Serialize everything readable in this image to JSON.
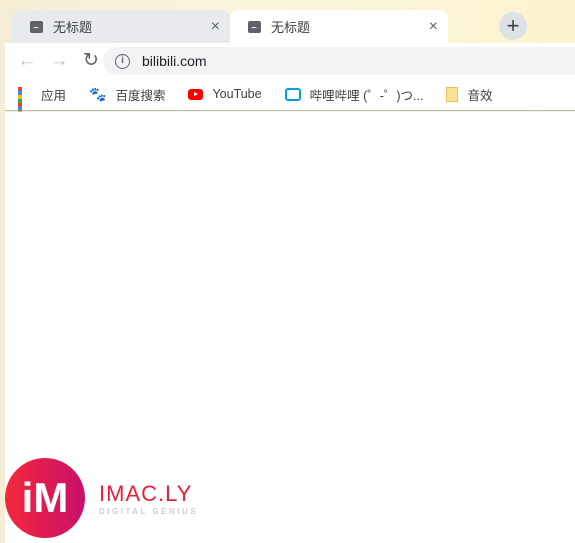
{
  "tabs": [
    {
      "title": "无标题",
      "active": false
    },
    {
      "title": "无标题",
      "active": true
    }
  ],
  "tab_close": "×",
  "new_tab": "+",
  "toolbar": {
    "back": "←",
    "forward": "→",
    "reload": "↻",
    "url": "bilibili.com",
    "info": "i"
  },
  "bookmarks": [
    {
      "label": "应用",
      "icon": "apps-icon"
    },
    {
      "label": "百度搜索",
      "icon": "baidu-paw-icon"
    },
    {
      "label": "YouTube",
      "icon": "youtube-icon"
    },
    {
      "label": "哔哩哔哩 (゜-゜)つ...",
      "icon": "bilibili-icon"
    },
    {
      "label": "音效",
      "icon": "folder-icon"
    }
  ],
  "watermark": {
    "logo_text": "iM",
    "name": "IMAC.LY",
    "tagline": "DIGITAL GENIUS"
  }
}
